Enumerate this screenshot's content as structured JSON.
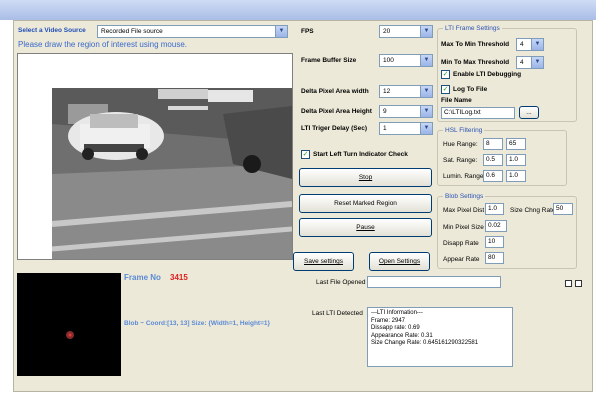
{
  "video_source": {
    "label": "Select a Video Source",
    "value": "Recorded File source"
  },
  "instruction": "Please draw the region of interest using mouse.",
  "fps": {
    "label": "FPS",
    "value": "20"
  },
  "frame_buffer": {
    "label": "Frame Buffer Size",
    "value": "100"
  },
  "delta_width": {
    "label": "Delta Pixel Area width",
    "value": "12"
  },
  "delta_height": {
    "label": "Delta Pixel Area Height",
    "value": "9"
  },
  "lti_delay": {
    "label": "LTI Triger Delay (Sec)",
    "value": "1"
  },
  "start_check": {
    "label": "Start Left Turn Indicator Check",
    "checked": true
  },
  "buttons": {
    "stop": "Stop",
    "reset": "Reset Marked Region",
    "pause": "Pause",
    "save": "Save settings",
    "open": "Open Settings",
    "browse": "..."
  },
  "lti_frame": {
    "title": "LTI Frame Settings",
    "max_to_min_label": "Max To Min Threshold",
    "max_to_min_value": "4",
    "min_to_max_label": "Min To Max Threshold",
    "min_to_max_value": "4",
    "enable_debug_label": "Enable LTI Debugging",
    "enable_debug_checked": true,
    "log_to_file_label": "Log To File",
    "log_to_file_checked": true,
    "file_name_label": "File Name",
    "file_name_value": "C:\\LTILog.txt"
  },
  "hsl": {
    "title": "HSL Filtering",
    "hue_label": "Hue Range:",
    "hue_min": "8",
    "hue_max": "65",
    "sat_label": "Sat. Range:",
    "sat_min": "0.5",
    "sat_max": "1.0",
    "lum_label": "Lumin. Range",
    "lum_min": "0.6",
    "lum_max": "1.0"
  },
  "blob": {
    "title": "Blob Settings",
    "max_pixel_dist_label": "Max Pixel Dist",
    "max_pixel_dist": "1.0",
    "size_chng_label": "Size Chng Rate",
    "size_chng": "50",
    "min_pixel_size_label": "Min Pixel Size",
    "min_pixel_size": "0.02",
    "disapp_label": "Disapp Rate",
    "disapp": "10",
    "appear_label": "Appear Rate",
    "appear": "80"
  },
  "frame_no": {
    "label": "Frame No",
    "value": "3415"
  },
  "blob_info": "Blob ~ Coord:[13, 13] Size: {Width=1, Height=1}",
  "last_file_label": "Last File Opened",
  "last_file_value": "",
  "last_lti_label": "Last LTI Detected",
  "lti_log": "---LTI Information---\nFrame: 2947\nDissapp rate: 0.69\nAppearance Rate: 0.31\nSize Change Rate: 0.645161290322581"
}
